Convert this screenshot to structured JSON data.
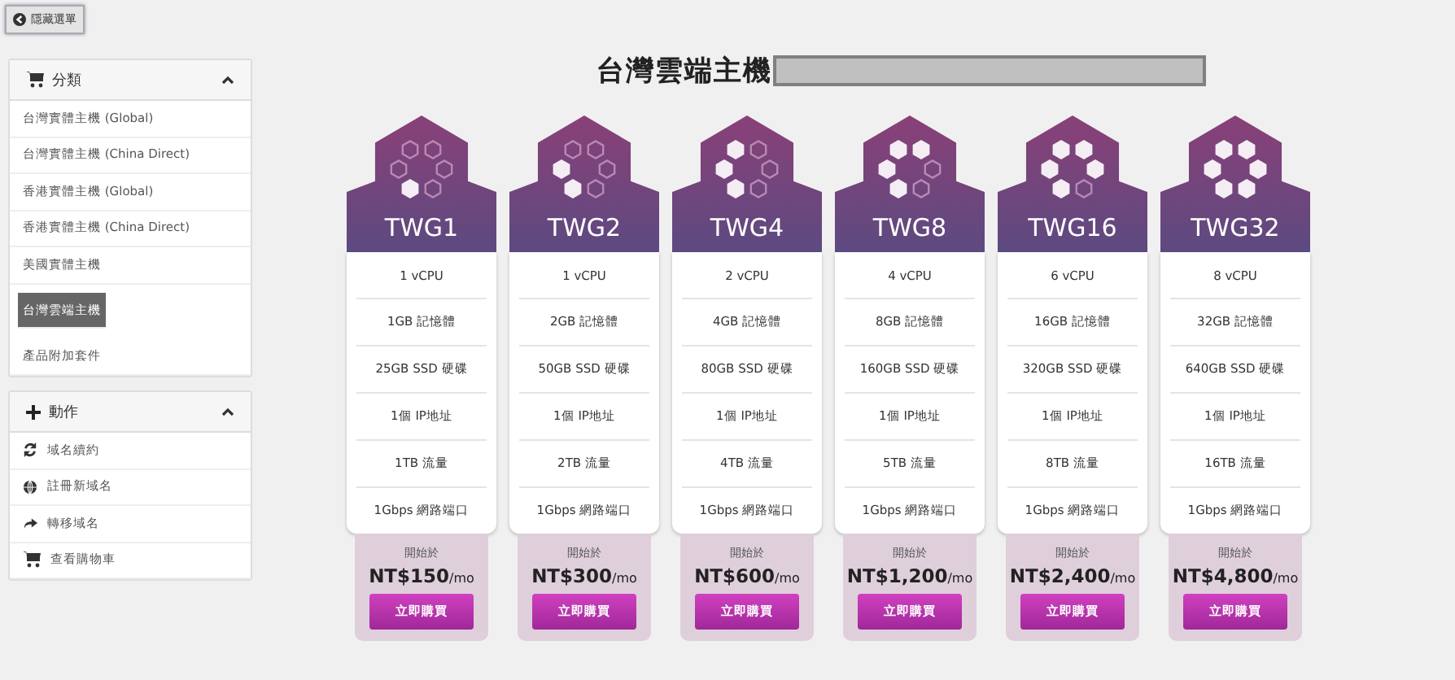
{
  "hide_menu_button": "隱藏選單",
  "categories": {
    "title": "分類",
    "items": [
      {
        "label": "台灣實體主機 (Global)",
        "selected": false
      },
      {
        "label": "台灣實體主機 (China Direct)",
        "selected": false
      },
      {
        "label": "香港實體主機 (Global)",
        "selected": false
      },
      {
        "label": "香港實體主機 (China Direct)",
        "selected": false
      },
      {
        "label": "美國實體主機",
        "selected": false
      },
      {
        "label": "台灣雲端主機",
        "selected": true
      },
      {
        "label": "產品附加套件",
        "selected": false
      }
    ]
  },
  "actions": {
    "title": "動作",
    "items": [
      {
        "label": "域名續約",
        "kind": "renew"
      },
      {
        "label": "註冊新域名",
        "kind": "globe"
      },
      {
        "label": "轉移域名",
        "kind": "transfer"
      },
      {
        "label": "查看購物車",
        "kind": "cart"
      }
    ]
  },
  "page_title": "台灣雲端主機",
  "plans": [
    {
      "name": "TWG1",
      "hexes": [
        false,
        false,
        false,
        false,
        true,
        false
      ],
      "features": [
        "1 vCPU",
        "1GB 記憶體",
        "25GB SSD 硬碟",
        "1個 IP地址",
        "1TB 流量",
        "1Gbps 網路端口"
      ],
      "from": "開始於",
      "price": "NT$150",
      "period": "/mo",
      "button": "立即購買"
    },
    {
      "name": "TWG2",
      "hexes": [
        false,
        false,
        false,
        false,
        true,
        true
      ],
      "features": [
        "1 vCPU",
        "2GB 記憶體",
        "50GB SSD 硬碟",
        "1個 IP地址",
        "2TB 流量",
        "1Gbps 網路端口"
      ],
      "from": "開始於",
      "price": "NT$300",
      "period": "/mo",
      "button": "立即購買"
    },
    {
      "name": "TWG4",
      "hexes": [
        true,
        false,
        false,
        false,
        true,
        true
      ],
      "features": [
        "2 vCPU",
        "4GB 記憶體",
        "80GB SSD 硬碟",
        "1個 IP地址",
        "4TB 流量",
        "1Gbps 網路端口"
      ],
      "from": "開始於",
      "price": "NT$600",
      "period": "/mo",
      "button": "立即購買"
    },
    {
      "name": "TWG8",
      "hexes": [
        true,
        true,
        false,
        false,
        true,
        true
      ],
      "features": [
        "4 vCPU",
        "8GB 記憶體",
        "160GB SSD 硬碟",
        "1個 IP地址",
        "5TB 流量",
        "1Gbps 網路端口"
      ],
      "from": "開始於",
      "price": "NT$1,200",
      "period": "/mo",
      "button": "立即購買"
    },
    {
      "name": "TWG16",
      "hexes": [
        true,
        true,
        true,
        false,
        true,
        true
      ],
      "features": [
        "6 vCPU",
        "16GB 記憶體",
        "320GB SSD 硬碟",
        "1個 IP地址",
        "8TB 流量",
        "1Gbps 網路端口"
      ],
      "from": "開始於",
      "price": "NT$2,400",
      "period": "/mo",
      "button": "立即購買"
    },
    {
      "name": "TWG32",
      "hexes": [
        true,
        true,
        true,
        true,
        true,
        true
      ],
      "features": [
        "8 vCPU",
        "32GB 記憶體",
        "640GB SSD 硬碟",
        "1個 IP地址",
        "16TB 流量",
        "1Gbps 網路端口"
      ],
      "from": "開始於",
      "price": "NT$4,800",
      "period": "/mo",
      "button": "立即購買"
    }
  ]
}
